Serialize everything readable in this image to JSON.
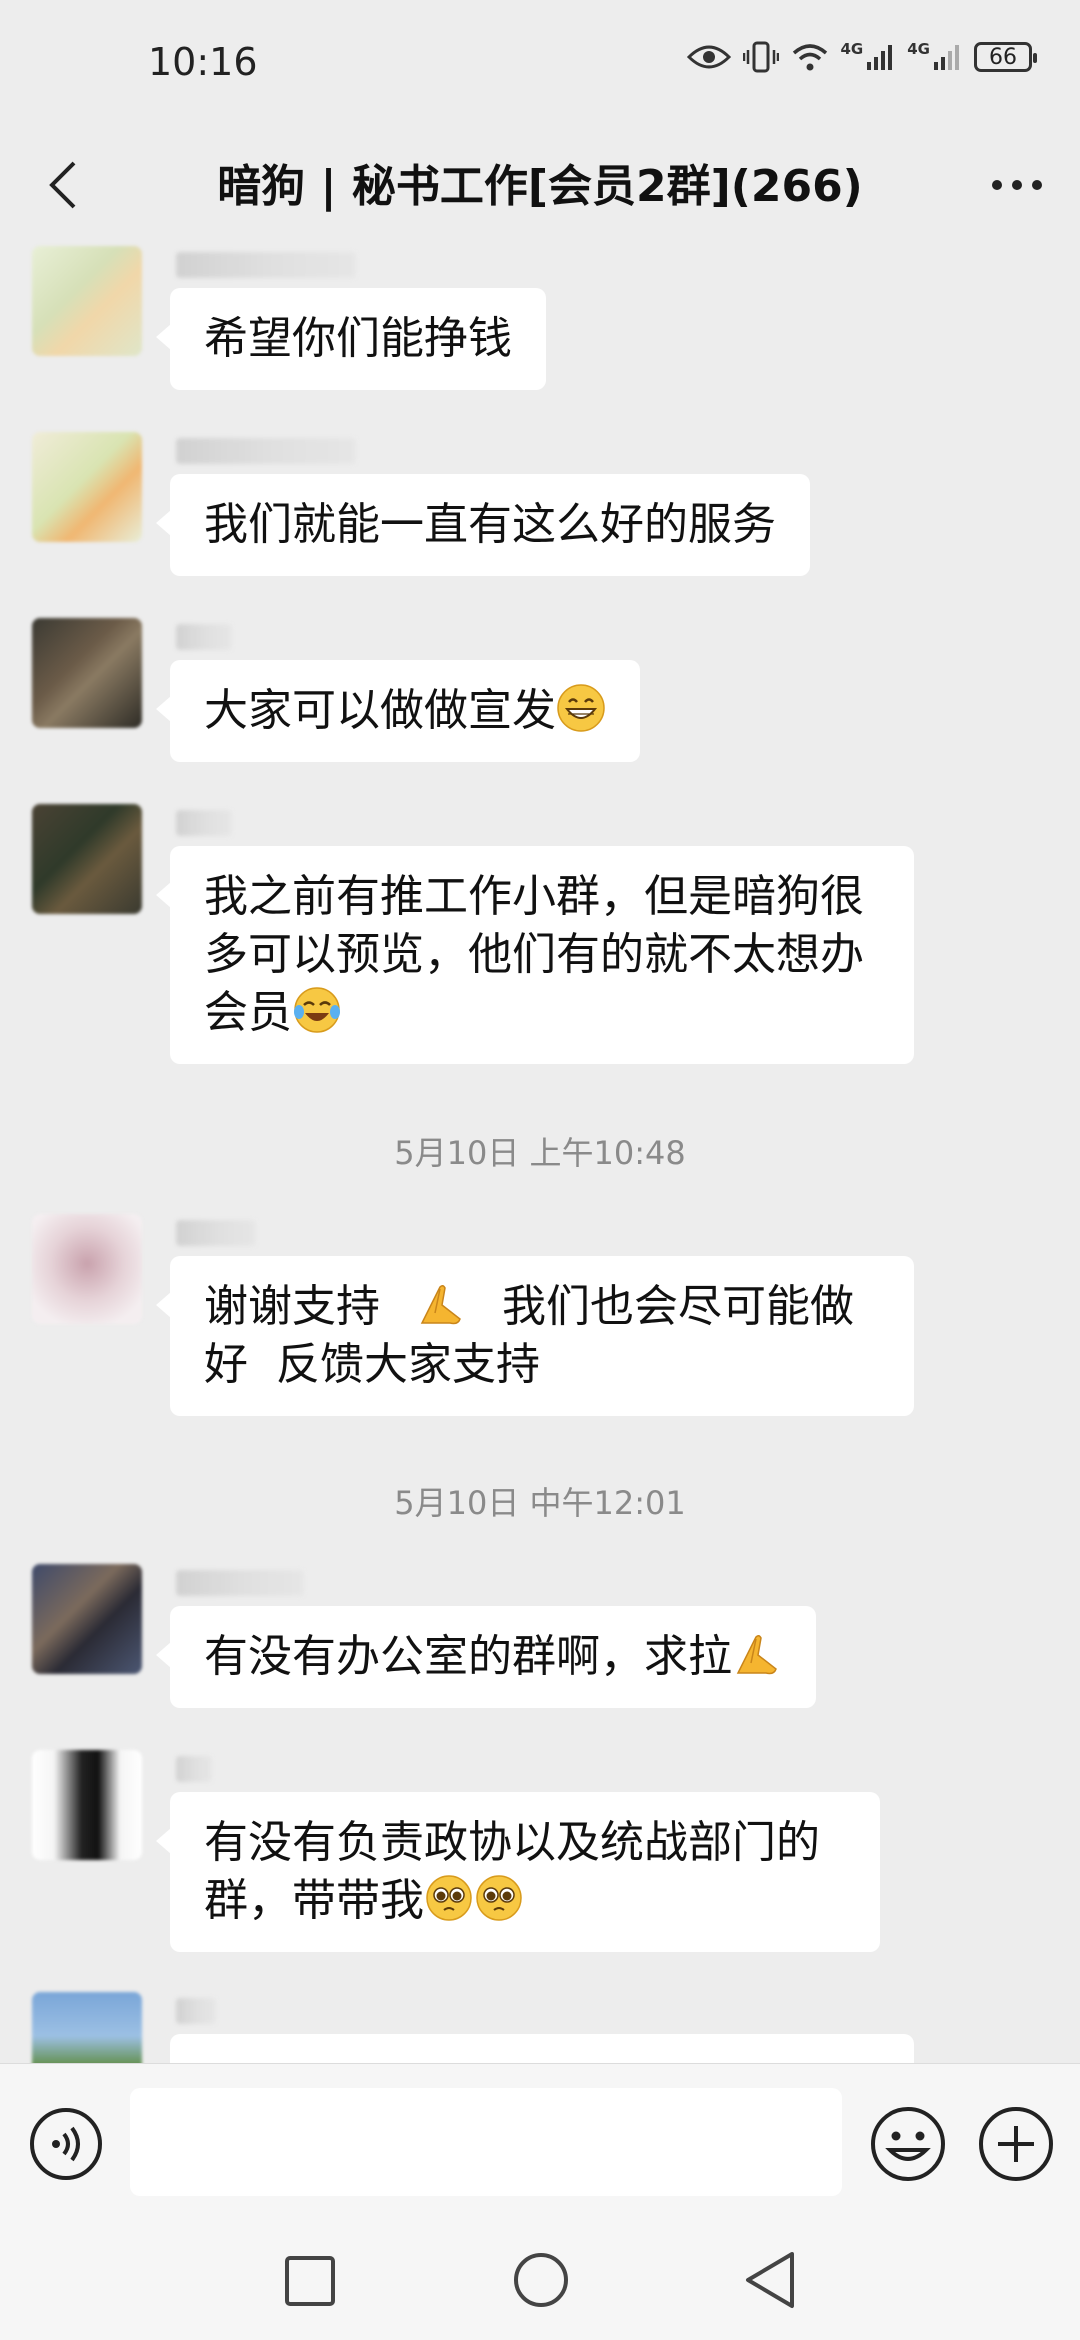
{
  "status_bar": {
    "time": "10:16",
    "network_1": "4G",
    "network_2": "4G",
    "battery": "66"
  },
  "header": {
    "title": "暗狗 | 秘书工作[会员2群](266)"
  },
  "messages": [
    {
      "text": "希望你们能挣钱",
      "emoji": ""
    },
    {
      "text": "我们就能一直有这么好的服务",
      "emoji": ""
    },
    {
      "text": "大家可以做做宣发",
      "emoji": "grinning-face-icon"
    },
    {
      "text": "我之前有推工作小群，但是暗狗很多可以预览，他们有的就不太想办会员",
      "emoji": "tears-of-joy-icon"
    }
  ],
  "timestamp_1": "5月10日 上午10:48",
  "message_5": {
    "text_a": "谢谢支持",
    "text_b": "我们也会尽可能做好  反馈大家支持",
    "emoji": "folded-hands-icon"
  },
  "timestamp_2": "5月10日 中午12:01",
  "message_6": {
    "text": "有没有办公室的群啊，求拉",
    "emoji": "folded-hands-icon"
  },
  "message_7": {
    "text": "有没有负责政协以及统战部门的群，带带我",
    "emoji": "pleading-face-icon"
  },
  "input": {
    "placeholder": ""
  },
  "colors": {
    "background": "#ededed",
    "bubble": "#ffffff",
    "bar": "#f6f6f6",
    "timestamp": "#8a8a8a"
  }
}
